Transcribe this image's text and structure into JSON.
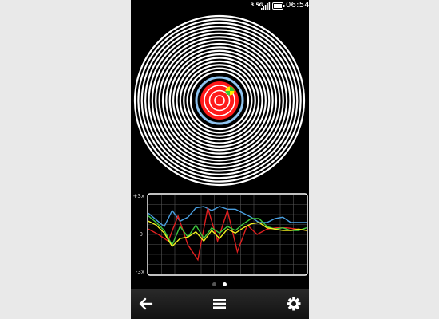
{
  "status_bar": {
    "network": "3.5G",
    "time": "06:54",
    "icons": [
      "signal-icon",
      "battery-icon"
    ]
  },
  "target": {
    "outer_rings": 17,
    "inner_rings": 3,
    "ring_color": "#ffffff",
    "center_color": "#ff1a1a",
    "halo_color": "#8fc4f0",
    "marker_colors": [
      "#ffee00",
      "#33cc33"
    ]
  },
  "graph": {
    "axis_max_label": "+3x",
    "axis_zero_label": "0",
    "axis_min_label": "-3x",
    "colors": {
      "blue": "#4a9fe0",
      "red": "#e02020",
      "green": "#3ec83e",
      "yellow": "#f0f020"
    }
  },
  "chart_data": {
    "type": "line",
    "ylim": [
      -3,
      3
    ],
    "x": [
      0,
      1,
      2,
      3,
      4,
      5,
      6,
      7,
      8,
      9,
      10,
      11,
      12,
      13,
      14,
      15,
      16,
      17,
      18,
      19,
      20
    ],
    "series": [
      {
        "values": [
          1.6,
          1.1,
          0.6,
          1.8,
          1.0,
          1.3,
          2.0,
          2.1,
          1.8,
          2.1,
          1.9,
          1.9,
          1.6,
          1.3,
          0.9,
          0.9,
          1.2,
          1.3,
          0.9,
          0.9,
          0.9
        ]
      },
      {
        "values": [
          0.4,
          0.0,
          -0.5,
          1.4,
          -0.8,
          -1.9,
          2.0,
          -0.5,
          1.8,
          -1.3,
          0.7,
          0.0,
          0.4,
          0.5,
          0.5,
          0.4,
          0.3
        ]
      },
      {
        "values": [
          1.4,
          0.9,
          0.3,
          -0.8,
          0.6,
          -0.2,
          0.7,
          -0.3,
          0.5,
          0.1,
          0.6,
          0.3,
          0.8,
          1.2,
          1.2,
          0.6,
          0.4,
          0.5,
          0.3,
          0.3,
          0.5
        ]
      },
      {
        "values": [
          1.0,
          0.7,
          0.1,
          -0.9,
          -0.3,
          -0.2,
          0.2,
          -0.5,
          0.3,
          -0.3,
          0.4,
          0.1,
          0.5,
          0.8,
          0.9,
          0.5,
          0.4,
          0.3,
          0.3,
          0.4,
          0.3
        ]
      }
    ]
  },
  "pager": {
    "pages": 2,
    "active": 2
  },
  "toolbar": {
    "icons": [
      "back-arrow-icon",
      "menu-icon",
      "settings-gear-icon"
    ]
  }
}
